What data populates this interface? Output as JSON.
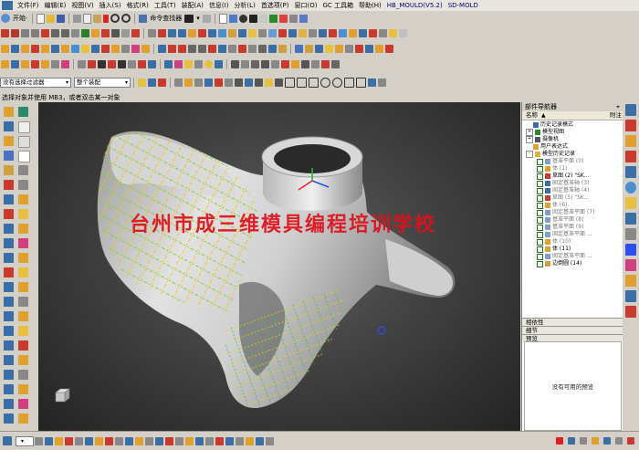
{
  "menubar": {
    "items": [
      "文件(F)",
      "编辑(E)",
      "视图(V)",
      "插入(S)",
      "格式(R)",
      "工具(T)",
      "装配(A)",
      "信息(I)",
      "分析(L)",
      "首选项(P)",
      "窗口(O)",
      "GC 工具箱",
      "帮助(H)",
      "HB_MOULD(V5.2)",
      "SD-MOLD"
    ]
  },
  "toolbar1": {
    "start_label": "开始·",
    "command_finder": "命令查找器"
  },
  "toolbar_filter": {
    "type_filter": "没有选择过滤器",
    "scope_filter": "整个装配"
  },
  "cue_line": "选择对象并使用 MB3，或者双击某一对象",
  "watermark": "台州市成三维模具编程培训学校",
  "navigator": {
    "title": "部件导航器",
    "col_name": "名称",
    "col_attach": "附注",
    "tree": [
      {
        "label": "历史记录模式",
        "level": 0,
        "expander": "",
        "icon": "hist"
      },
      {
        "label": "模型视图",
        "level": 0,
        "expander": "+",
        "icon": "view"
      },
      {
        "label": "摄像机",
        "level": 0,
        "expander": "+",
        "icon": "cam"
      },
      {
        "label": "用户表达式",
        "level": 0,
        "expander": "",
        "icon": "expr"
      },
      {
        "label": "模型历史记录",
        "level": 0,
        "expander": "-",
        "icon": "folder"
      },
      {
        "label": "基准平面 (0)",
        "level": 1,
        "grey": true,
        "icon": "plane"
      },
      {
        "label": "体 (1)",
        "level": 1,
        "grey": true,
        "icon": "body"
      },
      {
        "label": "草图 (2) \"SK...",
        "level": 1,
        "grey": false,
        "icon": "sketch"
      },
      {
        "label": "固定基准轴 (3)",
        "level": 1,
        "grey": true,
        "icon": "axis"
      },
      {
        "label": "固定基准轴 (4)",
        "level": 1,
        "grey": true,
        "icon": "axis"
      },
      {
        "label": "草图 (5) \"SK...",
        "level": 1,
        "grey": true,
        "icon": "sketch"
      },
      {
        "label": "体 (6)",
        "level": 1,
        "grey": true,
        "icon": "body"
      },
      {
        "label": "固定基准平面 (7)",
        "level": 1,
        "grey": true,
        "icon": "plane"
      },
      {
        "label": "基准平面 (8)",
        "level": 1,
        "grey": true,
        "icon": "plane"
      },
      {
        "label": "基准平面 (9)",
        "level": 1,
        "grey": true,
        "icon": "plane"
      },
      {
        "label": "固定基准平面 ...",
        "level": 1,
        "grey": true,
        "icon": "plane"
      },
      {
        "label": "体 (10)",
        "level": 1,
        "grey": true,
        "icon": "body"
      },
      {
        "label": "体 (11)",
        "level": 1,
        "grey": false,
        "icon": "body"
      },
      {
        "label": "固定基准平面 ...",
        "level": 1,
        "grey": true,
        "icon": "plane"
      },
      {
        "label": "边倒圆 (14)",
        "level": 1,
        "grey": false,
        "icon": "blend"
      }
    ],
    "section_dependents": "相依性",
    "section_details": "细节",
    "section_preview": "预览",
    "preview_empty": "没有可用的预览"
  },
  "colors": {
    "accent": "#3a6ea5",
    "watermark": "#e0101a",
    "viewport_bg": "#3c3c3c",
    "part_surface": "#d2d2d2"
  },
  "icons": {
    "toolbar1": [
      "new-file-icon",
      "open-folder-icon",
      "save-icon",
      "cut-icon",
      "copy-icon",
      "paste-icon",
      "undo-icon",
      "redo-icon",
      "fit-view-icon",
      "shaded-icon",
      "wire-icon",
      "layer-icon",
      "color-icon"
    ],
    "left": [
      "sketch-icon",
      "extrude-icon",
      "revolve-icon",
      "hole-icon",
      "blend-icon",
      "chamfer-icon",
      "shell-icon",
      "trim-icon",
      "mirror-icon",
      "pattern-icon",
      "offset-icon",
      "sew-icon"
    ],
    "resource": [
      "assembly-nav-icon",
      "constraint-nav-icon",
      "part-nav-icon",
      "reuse-library-icon",
      "history-icon",
      "web-browser-icon",
      "process-studio-icon",
      "roles-icon",
      "system-scene-icon",
      "palette-icon"
    ]
  }
}
